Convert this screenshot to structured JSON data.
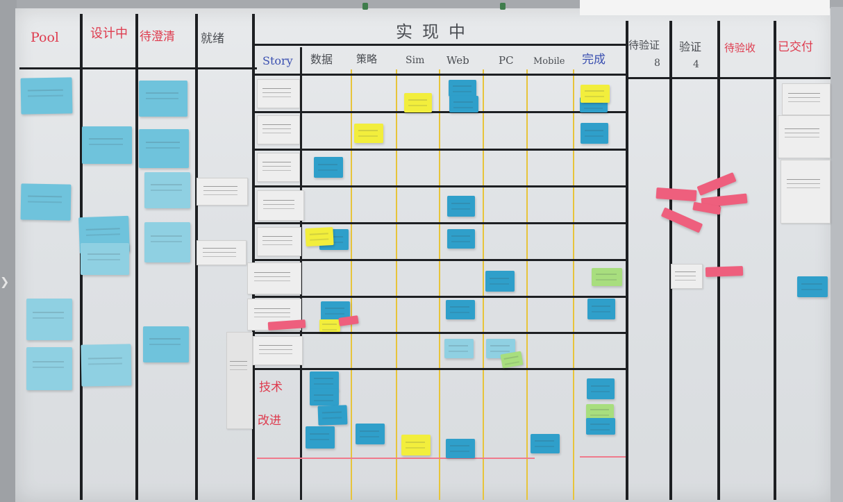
{
  "board": {
    "left_headers": [
      "Pool",
      "设计中",
      "待澄清",
      "就绪"
    ],
    "in_progress_header": "实现中",
    "stage_headers": [
      "Story",
      "数据",
      "策略",
      "Sim",
      "Web",
      "PC",
      "Mobile",
      "完成"
    ],
    "right_headers": [
      {
        "label": "待验证",
        "count": "8"
      },
      {
        "label": "验证",
        "count": "4"
      },
      {
        "label": "待验收",
        "count": ""
      },
      {
        "label": "已交付",
        "count": ""
      }
    ],
    "tech_debt_label_line1": "技术",
    "tech_debt_label_line2": "改进",
    "colors": {
      "header_red": "#de3b4e",
      "header_blue": "#3a4fb0",
      "sticky_cyan": "#6fc3dc",
      "sticky_blue": "#2f9fca",
      "sticky_yellow": "#f2ee3c",
      "sticky_green": "#a8de7e",
      "sticky_pink": "#ee5f7d",
      "lane_yellow": "#e7c43a"
    }
  }
}
